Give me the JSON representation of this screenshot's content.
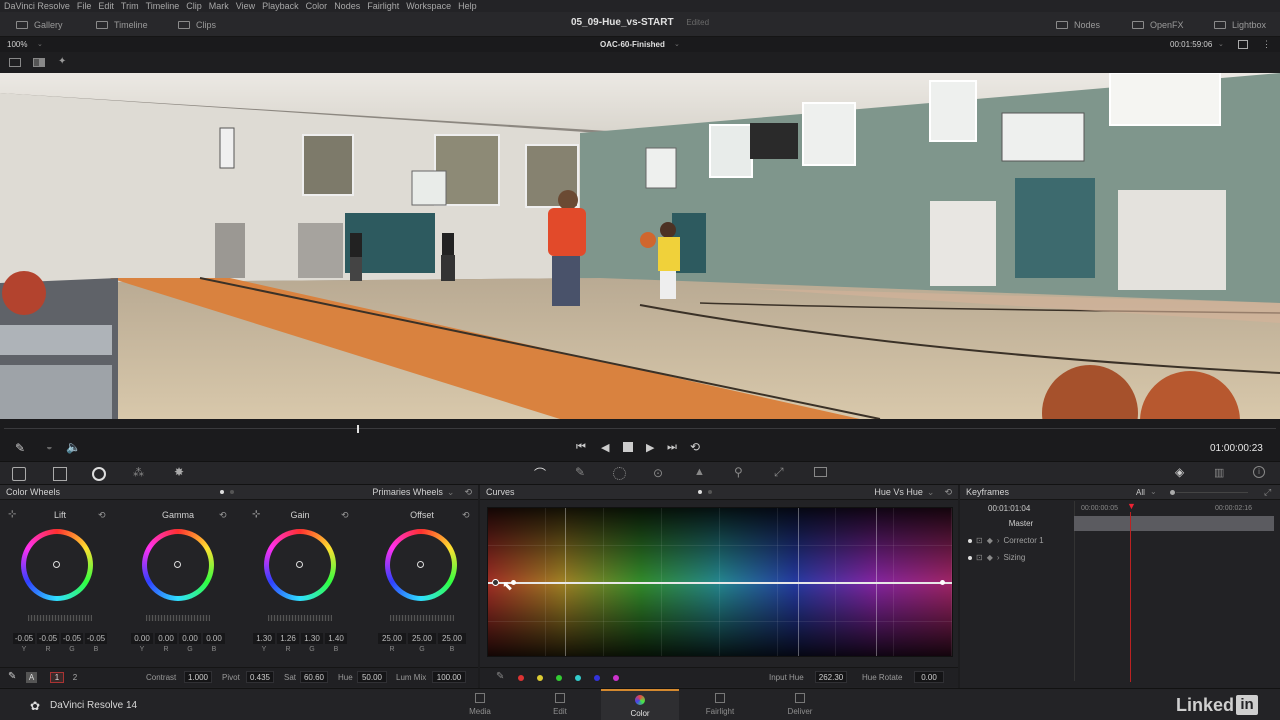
{
  "menu": [
    "DaVinci Resolve",
    "File",
    "Edit",
    "Trim",
    "Timeline",
    "Clip",
    "Mark",
    "View",
    "Playback",
    "Color",
    "Nodes",
    "Fairlight",
    "Workspace",
    "Help"
  ],
  "top": {
    "gallery": "Gallery",
    "timeline": "Timeline",
    "clips": "Clips",
    "project": "05_09-Hue_vs-START",
    "edited": "Edited",
    "nodes": "Nodes",
    "openfx": "OpenFX",
    "lightbox": "Lightbox"
  },
  "viewer": {
    "zoom": "100%",
    "timeline_name": "OAC-60-Finished",
    "timecode": "00:01:59:06",
    "playhead_timecode": "01:00:00:23"
  },
  "color_wheels": {
    "title": "Color Wheels",
    "mode": "Primaries Wheels",
    "wheels": [
      {
        "label": "Lift",
        "values": [
          "-0.05",
          "-0.05",
          "-0.05",
          "-0.05"
        ],
        "channels": [
          "Y",
          "R",
          "G",
          "B"
        ]
      },
      {
        "label": "Gamma",
        "values": [
          "0.00",
          "0.00",
          "0.00",
          "0.00"
        ],
        "channels": [
          "Y",
          "R",
          "G",
          "B"
        ]
      },
      {
        "label": "Gain",
        "values": [
          "1.30",
          "1.26",
          "1.30",
          "1.40"
        ],
        "channels": [
          "Y",
          "R",
          "G",
          "B"
        ]
      },
      {
        "label": "Offset",
        "values": [
          "25.00",
          "25.00",
          "25.00"
        ],
        "channels": [
          "R",
          "G",
          "B"
        ]
      }
    ],
    "footer": {
      "page1": "1",
      "page2": "2",
      "contrast_label": "Contrast",
      "contrast": "1.000",
      "pivot_label": "Pivot",
      "pivot": "0.435",
      "sat_label": "Sat",
      "sat": "60.60",
      "hue_label": "Hue",
      "hue": "50.00",
      "lummix_label": "Lum Mix",
      "lummix": "100.00"
    }
  },
  "curves": {
    "title": "Curves",
    "mode": "Hue Vs Hue",
    "input_hue_label": "Input Hue",
    "input_hue": "262.30",
    "hue_rotate_label": "Hue Rotate",
    "hue_rotate": "0.00"
  },
  "keyframes": {
    "title": "Keyframes",
    "filter": "All",
    "timecode": "00:01:01:04",
    "ruler_start": "00:00:00:05",
    "ruler_end": "00:00:02:16",
    "rows": [
      "Master",
      "Corrector 1",
      "Sizing"
    ]
  },
  "footer": {
    "app": "DaVinci Resolve 14",
    "pages": [
      "Media",
      "Edit",
      "Color",
      "Fairlight",
      "Deliver"
    ],
    "watermark": "Linked"
  }
}
